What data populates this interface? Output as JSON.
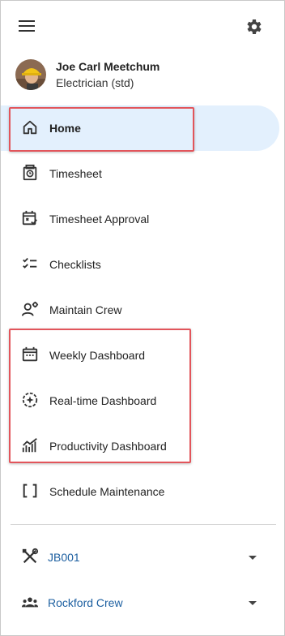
{
  "header": {
    "menu_icon": "hamburger-menu-icon",
    "settings_icon": "gear-icon"
  },
  "user": {
    "name": "Joe Carl Meetchum",
    "role": "Electrician (std)"
  },
  "nav": {
    "items": [
      {
        "label": "Home",
        "icon": "home-icon",
        "active": true
      },
      {
        "label": "Timesheet",
        "icon": "timesheet-icon"
      },
      {
        "label": "Timesheet Approval",
        "icon": "calendar-check-icon"
      },
      {
        "label": "Checklists",
        "icon": "checklist-icon"
      },
      {
        "label": "Maintain Crew",
        "icon": "crew-gear-icon"
      },
      {
        "label": "Weekly Dashboard",
        "icon": "calendar-icon"
      },
      {
        "label": "Real-time Dashboard",
        "icon": "realtime-icon"
      },
      {
        "label": "Productivity Dashboard",
        "icon": "chart-icon"
      },
      {
        "label": "Schedule Maintenance",
        "icon": "brackets-icon"
      }
    ]
  },
  "job_picker": {
    "label": "JB001",
    "icon": "tools-icon"
  },
  "crew_picker": {
    "label": "Rockford Crew",
    "icon": "group-icon"
  },
  "colors": {
    "active_bg": "#e3f0fd",
    "link": "#1c5fa0",
    "highlight": "#e2555b"
  }
}
